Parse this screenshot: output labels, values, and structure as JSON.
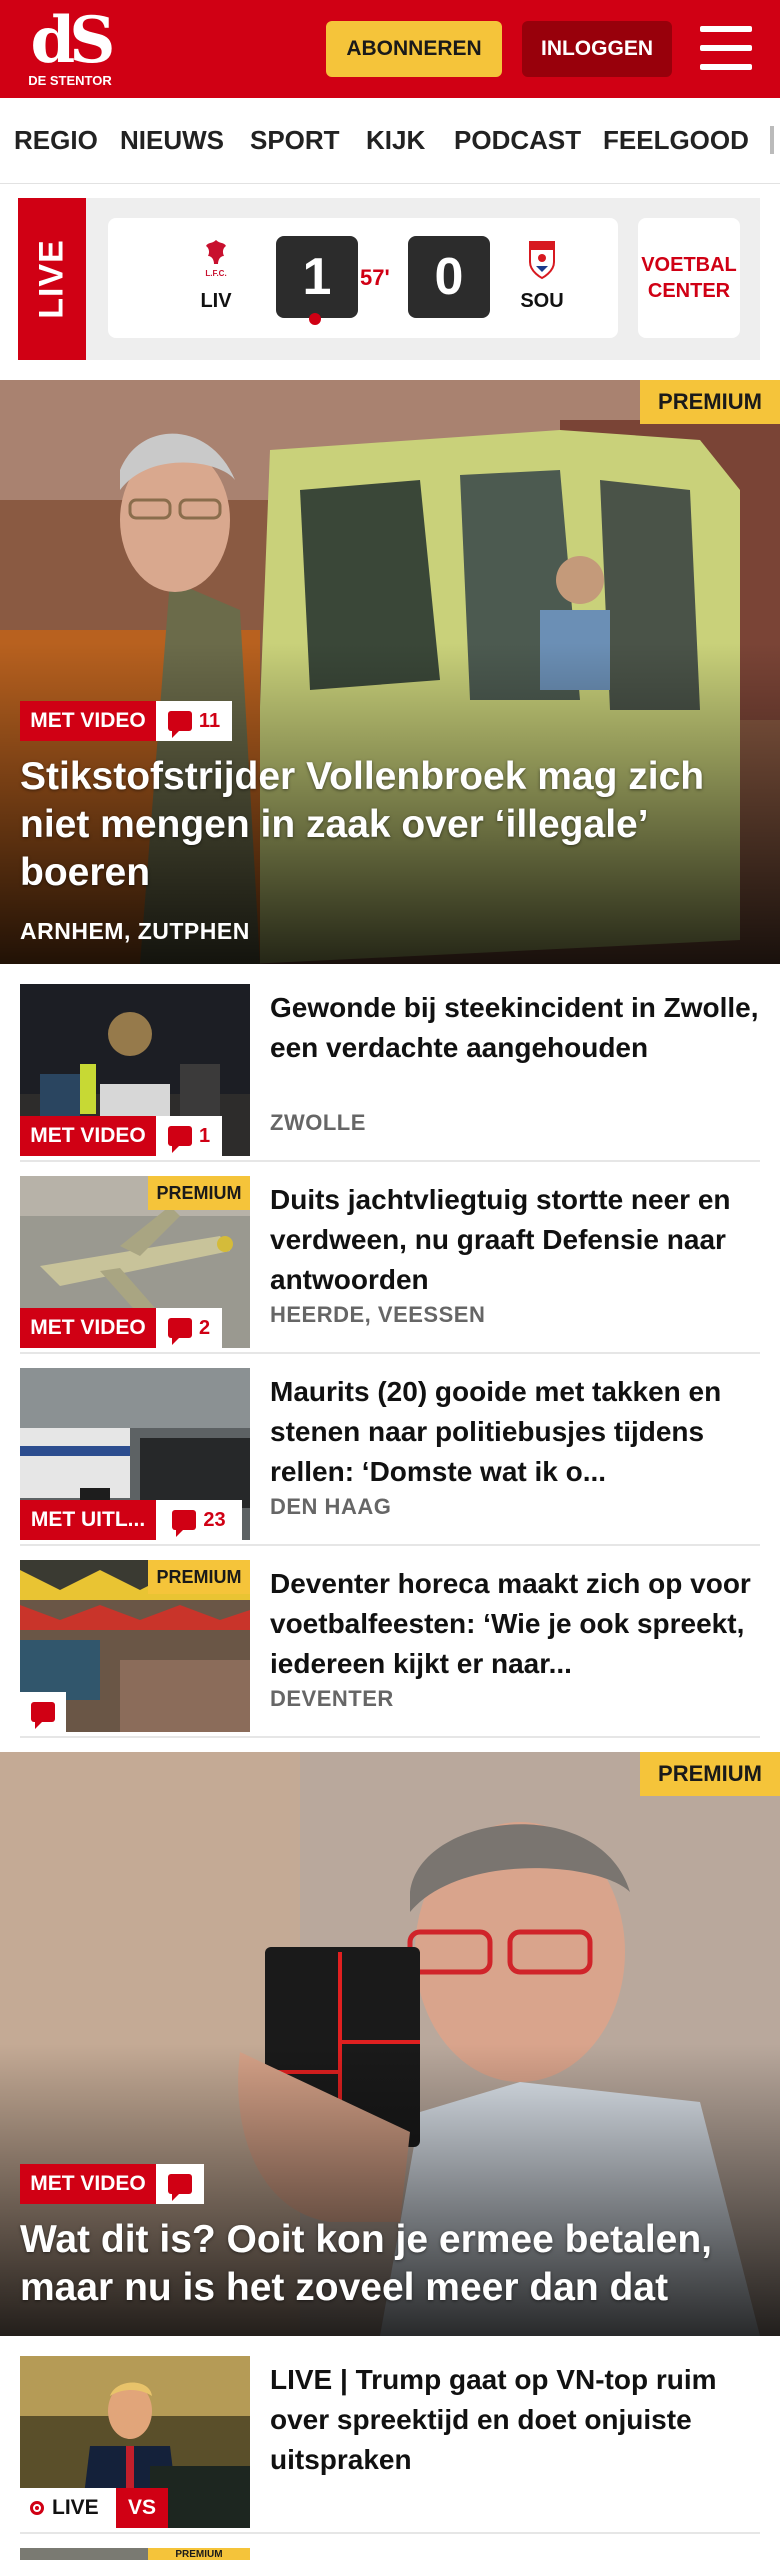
{
  "header": {
    "logo_text": "dS",
    "logo_subtitle": "DE STENTOR",
    "subscribe_label": "ABONNEREN",
    "login_label": "INLOGGEN",
    "menu_icon": "hamburger-menu-icon",
    "brand_color": "#d00014",
    "accent_color": "#f5c43a"
  },
  "nav": {
    "items": [
      {
        "label": "REGIO"
      },
      {
        "label": "NIEUWS"
      },
      {
        "label": "SPORT"
      },
      {
        "label": "KIJK"
      },
      {
        "label": "PODCAST"
      },
      {
        "label": "FEELGOOD"
      }
    ]
  },
  "live_score": {
    "live_label": "LIVE",
    "home_team": "LIV",
    "home_score": "1",
    "minute": "57'",
    "away_score": "0",
    "away_team": "SOU",
    "voetbal_center_line1": "VOETBAL",
    "voetbal_center_line2": "CENTER"
  },
  "hero1": {
    "premium": "PREMIUM",
    "video_label": "MET VIDEO",
    "comments": "11",
    "title": "Stikstofstrijder Vollenbroek mag zich niet mengen in zaak over ‘illegale’ boeren",
    "location": "ARNHEM, ZUTPHEN"
  },
  "articles": [
    {
      "title": "Gewonde bij steekincident in Zwolle, een verdachte aangehou­den",
      "location": "ZWOLLE",
      "video_label": "MET VIDEO",
      "comments": "1"
    },
    {
      "title": "Duits jachtvliegtuig stortte neer en verdween, nu graaft Defensie naar antwoorden",
      "location": "HEERDE, VEESSEN",
      "premium": "PREMIUM",
      "video_label": "MET VIDEO",
      "comments": "2"
    },
    {
      "title": "Maurits (20) gooide met takken en stenen naar politiebusjes tijdens rellen: ‘Domste wat ik o...",
      "location": "DEN HAAG",
      "video_label": "MET UITL...",
      "comments": "23"
    },
    {
      "title": "Deventer horeca maakt zich op voor voetbalfeesten: ‘Wie je ook spreekt, iedereen kijkt er naar...",
      "location": "DEVENTER",
      "premium": "PREMIUM"
    }
  ],
  "hero2": {
    "premium": "PREMIUM",
    "video_label": "MET VIDEO",
    "title": "Wat dit is? Ooit kon je ermee betalen, maar nu is het zoveel meer dan dat"
  },
  "live_article": {
    "title": "LIVE | Trump gaat op VN-top ruim over spreektijd en doet onjuiste uitspraken",
    "live_label": "LIVE",
    "vs_label": "VS"
  },
  "bottom_article": {
    "premium": "PREMIUM"
  }
}
